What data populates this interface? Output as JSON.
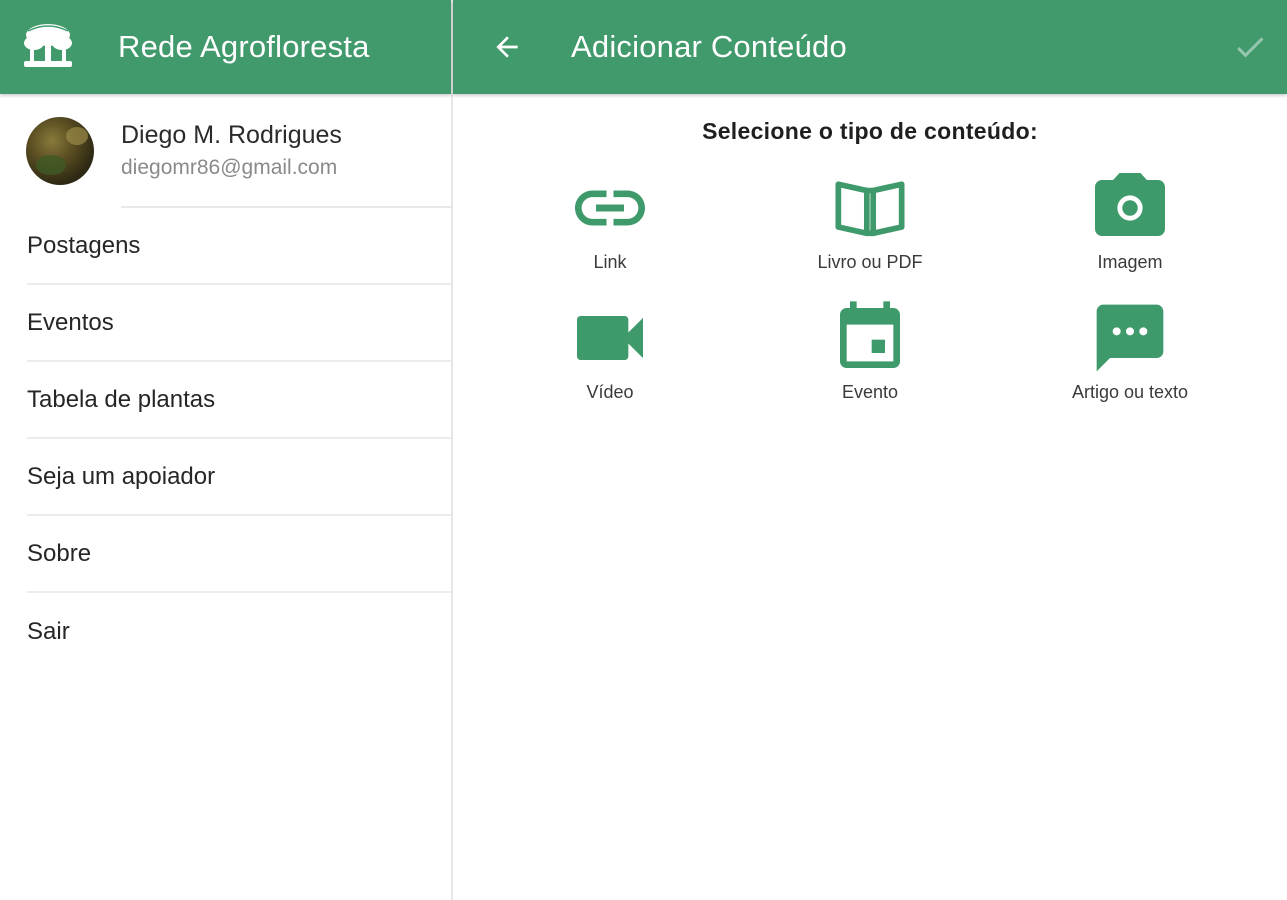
{
  "colors": {
    "accent": "#409a6c",
    "accent_icon": "#3f9a6b"
  },
  "drawer": {
    "app_title": "Rede Agrofloresta",
    "logo_icon": "tree-logo",
    "user": {
      "name": "Diego M. Rodrigues",
      "email": "diegomr86@gmail.com"
    },
    "menu": [
      {
        "label": "Postagens"
      },
      {
        "label": "Eventos"
      },
      {
        "label": "Tabela de plantas"
      },
      {
        "label": "Seja um apoiador"
      },
      {
        "label": "Sobre"
      },
      {
        "label": "Sair"
      }
    ]
  },
  "main": {
    "title": "Adicionar Conteúdo",
    "back_icon": "arrow-back-icon",
    "confirm_icon": "check-icon",
    "prompt": "Selecione o tipo de conteúdo:",
    "content_types": [
      {
        "label": "Link",
        "icon": "link-icon"
      },
      {
        "label": "Livro ou PDF",
        "icon": "book-icon"
      },
      {
        "label": "Imagem",
        "icon": "camera-icon"
      },
      {
        "label": "Vídeo",
        "icon": "videocam-icon"
      },
      {
        "label": "Evento",
        "icon": "calendar-icon"
      },
      {
        "label": "Artigo ou texto",
        "icon": "comment-icon"
      }
    ]
  }
}
